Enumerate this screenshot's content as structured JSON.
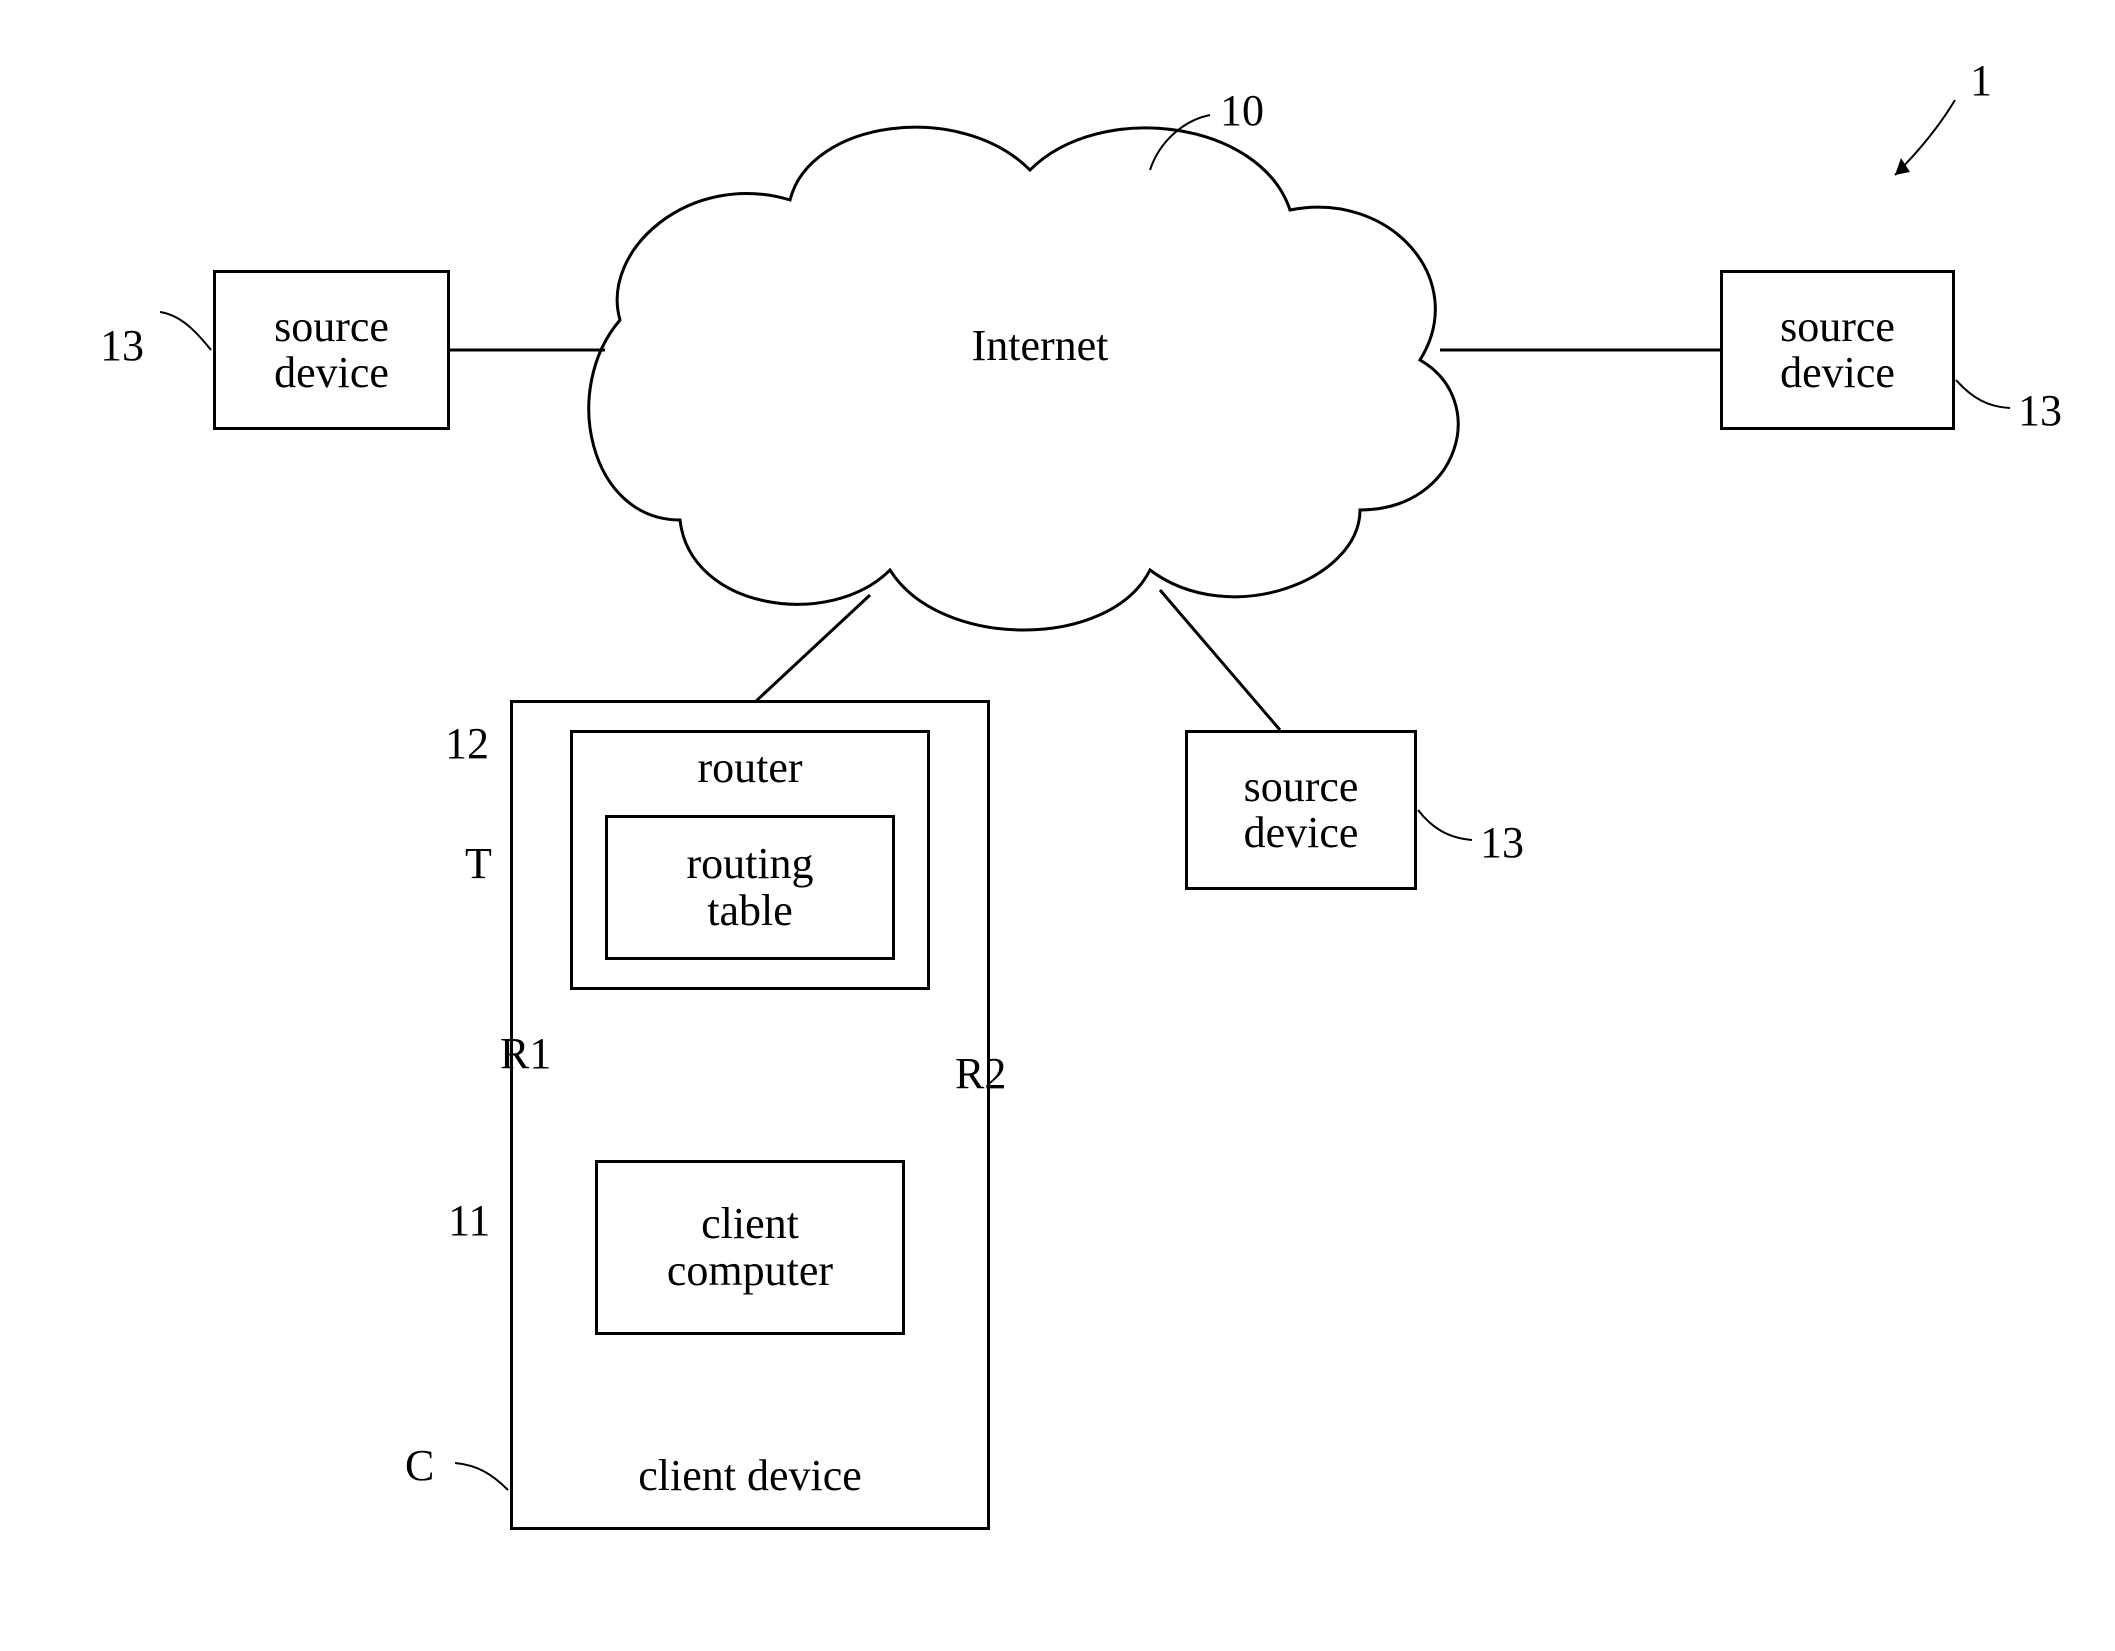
{
  "figure": {
    "ref_1": "1",
    "internet": {
      "label": "Internet",
      "ref": "10"
    },
    "source_left": {
      "line1": "source",
      "line2": "device",
      "ref": "13"
    },
    "source_right": {
      "line1": "source",
      "line2": "device",
      "ref": "13"
    },
    "source_bottom": {
      "line1": "source",
      "line2": "device",
      "ref": "13"
    },
    "client_device": {
      "label": "client device",
      "ref_C": "C",
      "router": {
        "label": "router",
        "ref": "12"
      },
      "routing_table": {
        "line1": "routing",
        "line2": "table",
        "ref_T": "T"
      },
      "client_computer": {
        "line1": "client",
        "line2": "computer",
        "ref": "11"
      },
      "r1": "R1",
      "r2": "R2"
    }
  }
}
